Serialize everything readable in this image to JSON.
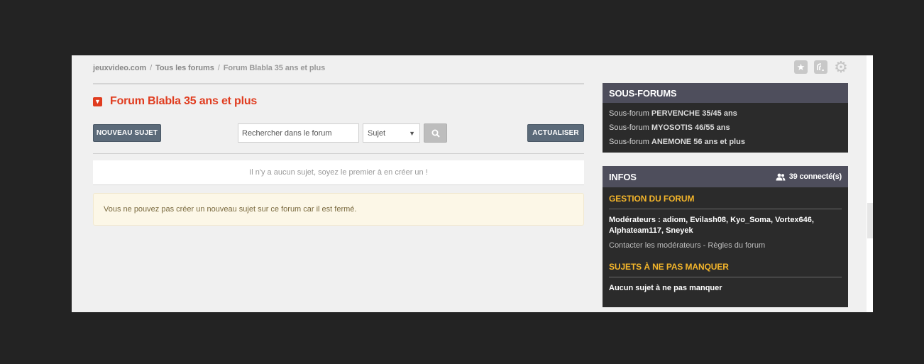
{
  "breadcrumb": {
    "home": "jeuxvideo.com",
    "forums": "Tous les forums",
    "current": "Forum Blabla 35 ans et plus",
    "separator": "/"
  },
  "forum": {
    "title": "Forum Blabla 35 ans et plus"
  },
  "toolbar": {
    "new_topic": "NOUVEAU SUJET",
    "search_placeholder": "Rechercher dans le forum",
    "search_type": "Sujet",
    "refresh": "ACTUALISER"
  },
  "messages": {
    "empty": "Il n'y a aucun sujet, soyez le premier à en créer un !",
    "closed": "Vous ne pouvez pas créer un nouveau sujet sur ce forum car il est fermé."
  },
  "subforums": {
    "title": "SOUS-FORUMS",
    "items": [
      {
        "prefix": "Sous-forum ",
        "name": "PERVENCHE 35/45 ans"
      },
      {
        "prefix": "Sous-forum ",
        "name": "MYOSOTIS 46/55 ans"
      },
      {
        "prefix": "Sous-forum ",
        "name": "ANEMONE 56 ans et plus"
      }
    ]
  },
  "infos": {
    "title": "INFOS",
    "connected": "39 connecté(s)",
    "gestion_title": "GESTION DU FORUM",
    "moderators": "Modérateurs : adiom, Evilash08, Kyo_Soma, Vortex646, Alphateam117, Sneyek",
    "contact_mods": "Contacter les modérateurs",
    "link_sep": " - ",
    "rules": "Règles du forum",
    "must_see_title": "SUJETS À NE PAS MANQUER",
    "must_see_empty": "Aucun sujet à ne pas manquer"
  },
  "colors": {
    "accent": "#e03c1f",
    "button": "#5b6a79",
    "panel_header": "#4e4e5c",
    "panel_bg": "#2b2b2b",
    "section_title": "#f3b52b"
  },
  "icons": [
    "star-icon",
    "notification-icon",
    "gear-icon",
    "chevron-down-icon",
    "search-icon",
    "users-icon"
  ]
}
